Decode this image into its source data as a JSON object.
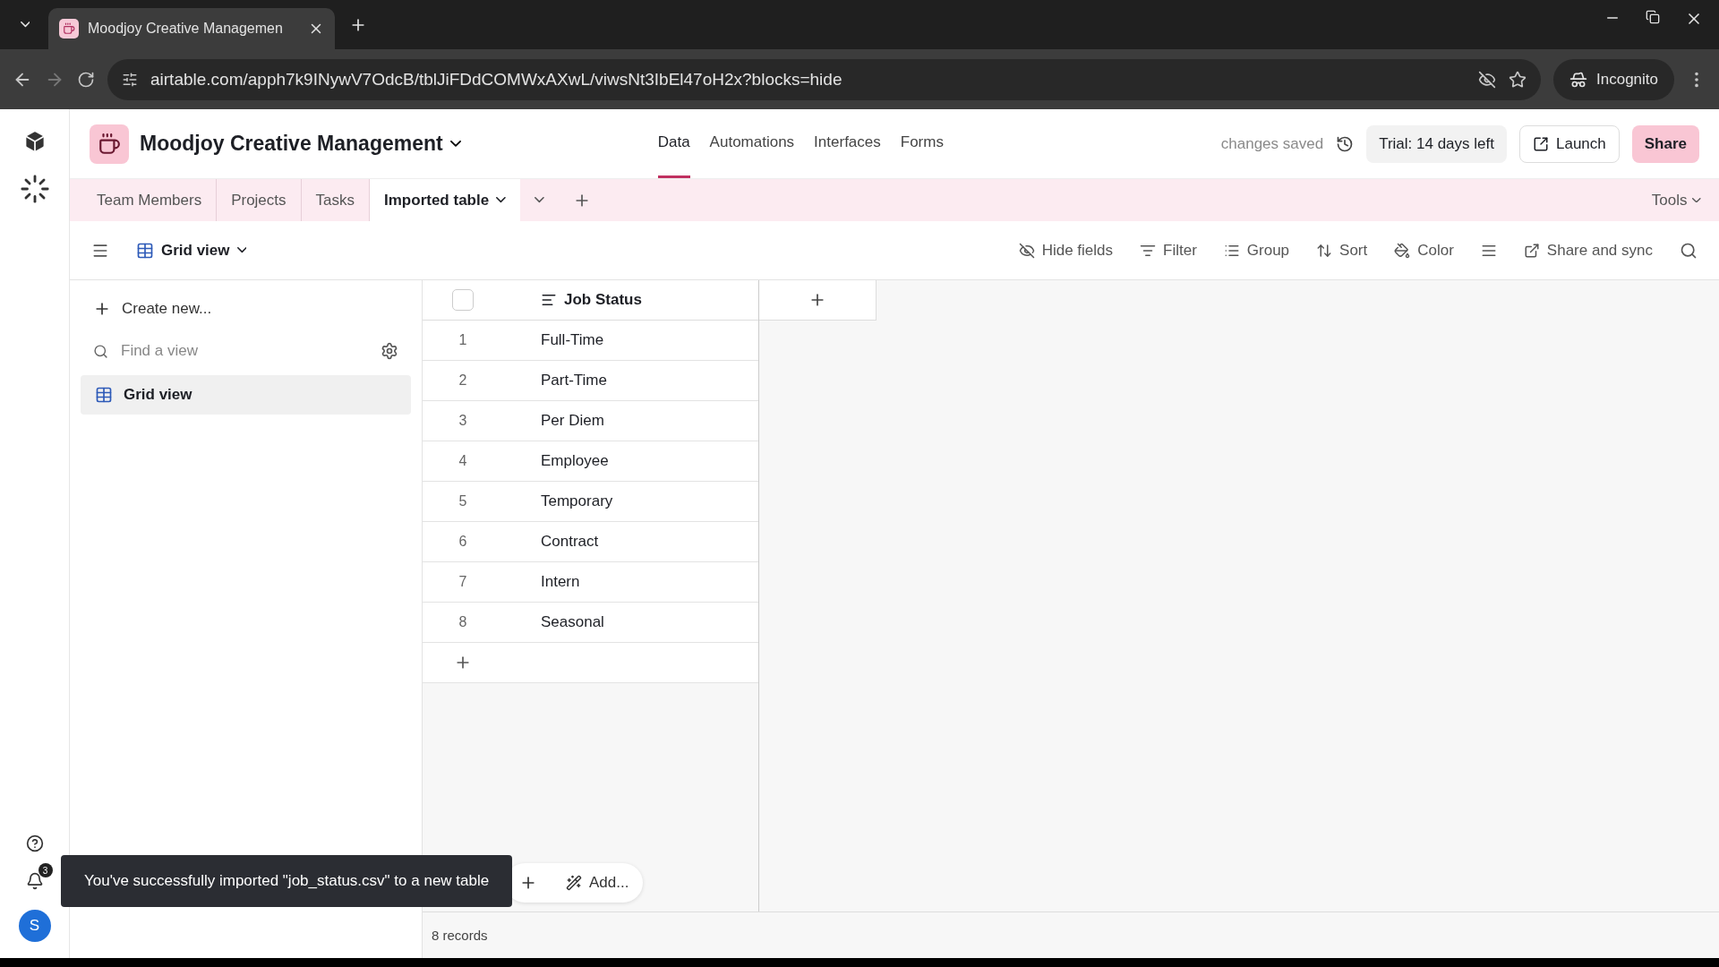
{
  "browser": {
    "tabs": [
      {
        "title": "Moodjoy Creative Managemen",
        "selected": true
      }
    ],
    "url": "airtable.com/apph7k9INywV7OdcB/tblJiFDdCOMWxAXwL/viwsNt3IbEl47oH2x?blocks=hide",
    "profile": "Incognito"
  },
  "header": {
    "base_name": "Moodjoy Creative Management",
    "nav": [
      {
        "label": "Data",
        "selected": true
      },
      {
        "label": "Automations",
        "selected": false
      },
      {
        "label": "Interfaces",
        "selected": false
      },
      {
        "label": "Forms",
        "selected": false
      }
    ],
    "status": "changes saved",
    "trial": "Trial: 14 days left",
    "launch": "Launch",
    "share": "Share"
  },
  "tables": {
    "items": [
      {
        "label": "Team Members",
        "selected": false
      },
      {
        "label": "Projects",
        "selected": false
      },
      {
        "label": "Tasks",
        "selected": false
      },
      {
        "label": "Imported table",
        "selected": true
      }
    ],
    "tools": "Tools"
  },
  "toolbar": {
    "view": "Grid view",
    "actions": [
      "Hide fields",
      "Filter",
      "Group",
      "Sort",
      "Color",
      "Share and sync"
    ]
  },
  "sidebar": {
    "create": "Create new...",
    "search_placeholder": "Find a view",
    "views": [
      {
        "label": "Grid view",
        "selected": true
      }
    ]
  },
  "grid": {
    "select_all_checked": false,
    "column": "Job Status",
    "rows": [
      {
        "number": "1",
        "value": "Full-Time"
      },
      {
        "number": "2",
        "value": "Part-Time"
      },
      {
        "number": "3",
        "value": "Per Diem"
      },
      {
        "number": "4",
        "value": "Employee"
      },
      {
        "number": "5",
        "value": "Temporary"
      },
      {
        "number": "6",
        "value": "Contract"
      },
      {
        "number": "7",
        "value": "Intern"
      },
      {
        "number": "8",
        "value": "Seasonal"
      }
    ],
    "add_label": "Add...",
    "record_count": "8 records"
  },
  "rail": {
    "notification_count": "3",
    "avatar": "S"
  },
  "toast": "You've successfully imported \"job_status.csv\" to a new table"
}
